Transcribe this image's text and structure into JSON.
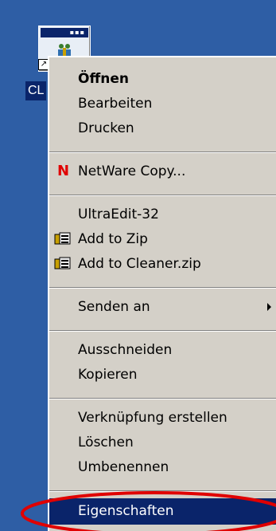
{
  "desktop": {
    "icon": {
      "label": "CL",
      "icon_name": "program-shortcut-icon",
      "overlay_icon": "shortcut-arrow-icon"
    }
  },
  "context_menu": {
    "items": [
      {
        "label": "Öffnen",
        "bold": true
      },
      {
        "label": "Bearbeiten"
      },
      {
        "label": "Drucken"
      },
      {
        "label": "NetWare Copy...",
        "icon": "netware-n-icon",
        "icon_text": "N"
      },
      {
        "label": "UltraEdit-32"
      },
      {
        "label": "Add to Zip",
        "icon": "winzip-icon"
      },
      {
        "label": "Add to Cleaner.zip",
        "icon": "winzip-icon"
      },
      {
        "label": "Senden an",
        "submenu": true
      },
      {
        "label": "Ausschneiden"
      },
      {
        "label": "Kopieren"
      },
      {
        "label": "Verknüpfung erstellen"
      },
      {
        "label": "Löschen"
      },
      {
        "label": "Umbenennen"
      },
      {
        "label": "Eigenschaften",
        "selected": true
      }
    ]
  },
  "colors": {
    "desktop": "#2e5ea5",
    "menu_background": "#d4d0c8",
    "selection": "#0a246a",
    "annotation": "#e00000",
    "netware_n": "#e00000"
  },
  "annotation": {
    "shape": "ellipse",
    "target": "Eigenschaften"
  }
}
